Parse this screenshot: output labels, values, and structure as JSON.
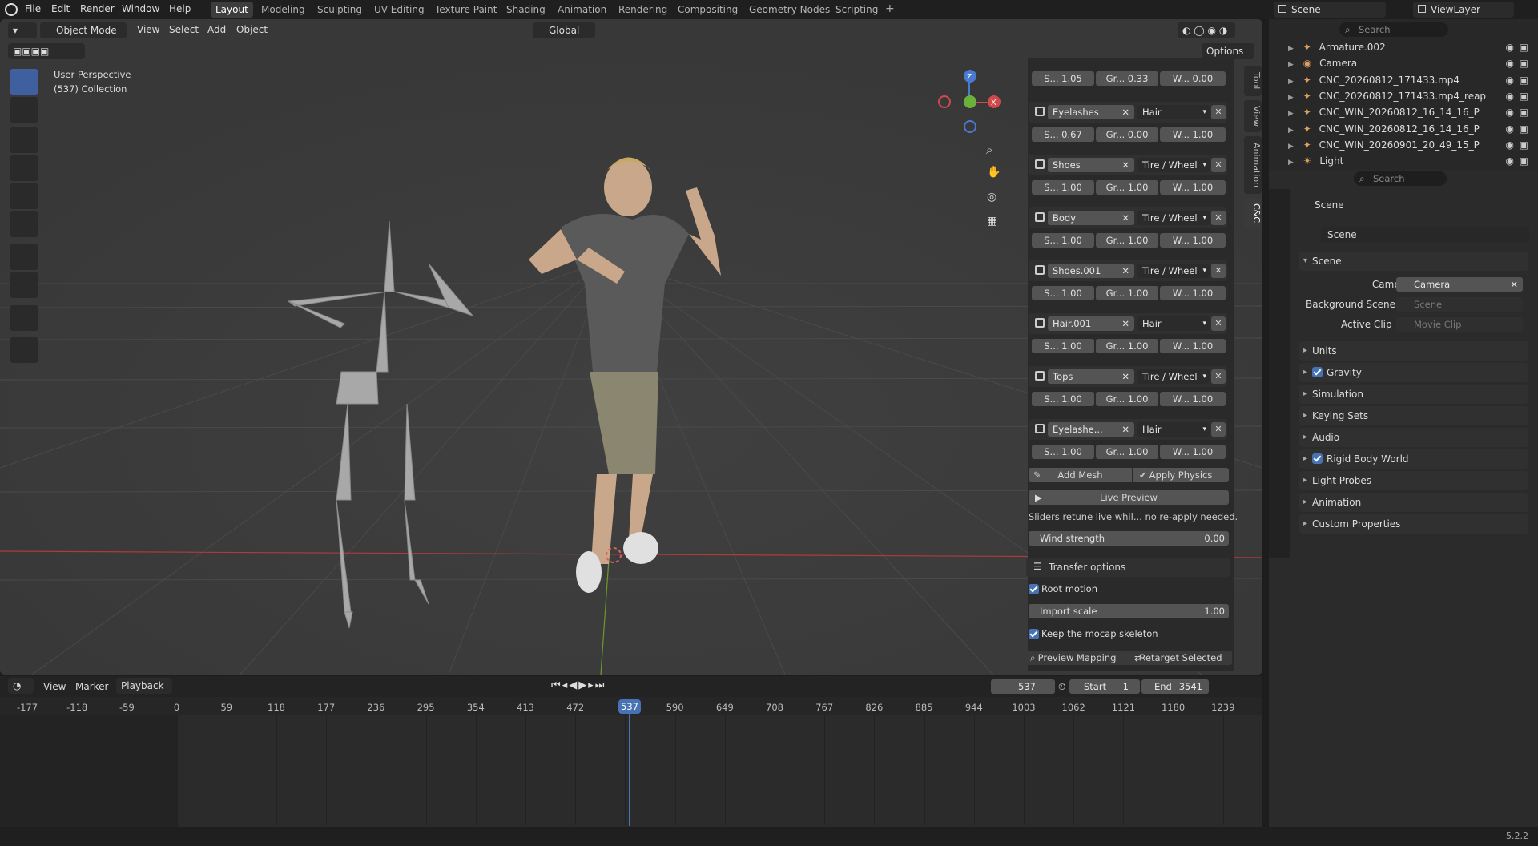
{
  "app": {
    "version": "5.2.2"
  },
  "menus": [
    "File",
    "Edit",
    "Render",
    "Window",
    "Help"
  ],
  "workspaces": [
    "Layout",
    "Modeling",
    "Sculpting",
    "UV Editing",
    "Texture Paint",
    "Shading",
    "Animation",
    "Rendering",
    "Compositing",
    "Geometry Nodes",
    "Scripting"
  ],
  "workspace_active": "Layout",
  "top_right": {
    "scene": "Scene",
    "view_layer": "ViewLayer"
  },
  "viewport_header": {
    "mode": "Object Mode",
    "view": "View",
    "select": "Select",
    "add": "Add",
    "object": "Object",
    "orientation": "Global",
    "options": "Options"
  },
  "viewport": {
    "perspective": "User Perspective",
    "collection": "(537) Collection",
    "axis": {
      "z": "Z",
      "x": "X"
    }
  },
  "side_tabs": [
    "Tool",
    "View",
    "Animation",
    "C&C"
  ],
  "slots": [
    {
      "name": "",
      "type": "",
      "s": "S... 1.05",
      "gr": "Gr... 0.33",
      "w": "W... 0.00"
    },
    {
      "name": "Eyelashes",
      "type": "Hair",
      "s": "S... 0.67",
      "gr": "Gr... 0.00",
      "w": "W... 1.00"
    },
    {
      "name": "Shoes",
      "type": "Tire / Wheel",
      "s": "S... 1.00",
      "gr": "Gr... 1.00",
      "w": "W... 1.00"
    },
    {
      "name": "Body",
      "type": "Tire / Wheel",
      "s": "S... 1.00",
      "gr": "Gr... 1.00",
      "w": "W... 1.00"
    },
    {
      "name": "Shoes.001",
      "type": "Tire / Wheel",
      "s": "S... 1.00",
      "gr": "Gr... 1.00",
      "w": "W... 1.00"
    },
    {
      "name": "Hair.001",
      "type": "Hair",
      "s": "S... 1.00",
      "gr": "Gr... 1.00",
      "w": "W... 1.00"
    },
    {
      "name": "Tops",
      "type": "Tire / Wheel",
      "s": "S... 1.00",
      "gr": "Gr... 1.00",
      "w": "W... 1.00"
    },
    {
      "name": "Eyelashe...",
      "type": "Hair",
      "s": "S... 1.00",
      "gr": "Gr... 1.00",
      "w": "W... 1.00"
    }
  ],
  "panel": {
    "add_mesh": "Add Mesh",
    "apply_physics": "Apply Physics",
    "live_preview": "Live Preview",
    "hint": "Sliders retune live whil... no re-apply needed.",
    "wind_label": "Wind strength",
    "wind_value": "0.00",
    "transfer": "Transfer options",
    "root_motion": "Root motion",
    "import_label": "Import scale",
    "import_value": "1.00",
    "keep_skeleton": "Keep the mocap skeleton",
    "preview_mapping": "Preview Mapping",
    "retarget": "Retarget Selected"
  },
  "outliner": {
    "search_placeholder": "Search",
    "items": [
      "Armature.002",
      "Camera",
      "CNC_20260812_171433.mp4",
      "CNC_20260812_171433.mp4_reap",
      "CNC_WIN_20260812_16_14_16_P",
      "CNC_WIN_20260812_16_14_16_P",
      "CNC_WIN_20260901_20_49_15_P",
      "Light"
    ]
  },
  "properties": {
    "search_placeholder": "Search",
    "header": "Scene",
    "datablock": "Scene",
    "section": "Scene",
    "camera_label": "Camera",
    "camera_value": "Camera",
    "bg_label": "Background Scene",
    "bg_placeholder": "Scene",
    "clip_label": "Active Clip",
    "clip_placeholder": "Movie Clip",
    "subsections": [
      "Units",
      "Gravity",
      "Simulation",
      "Keying Sets",
      "Audio",
      "Rigid Body World",
      "Light Probes",
      "Animation",
      "Custom Properties"
    ]
  },
  "timeline": {
    "view": "View",
    "marker": "Marker",
    "playback": "Playback",
    "current_frame": "537",
    "start_label": "Start",
    "start": "1",
    "end_label": "End",
    "end": "3541",
    "ticks": [
      "-177",
      "-118",
      "-59",
      "0",
      "59",
      "118",
      "177",
      "236",
      "295",
      "354",
      "413",
      "472",
      "537",
      "590",
      "649",
      "708",
      "767",
      "826",
      "885",
      "944",
      "1003",
      "1062",
      "1121",
      "1180",
      "1239"
    ]
  }
}
